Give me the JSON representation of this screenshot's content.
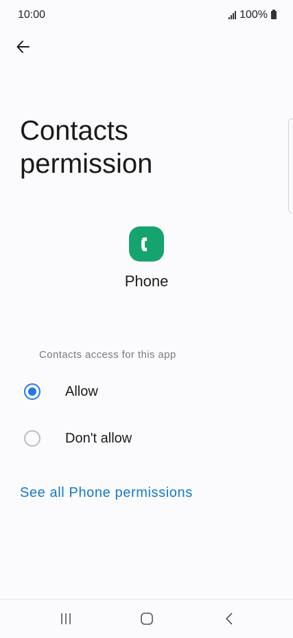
{
  "status_bar": {
    "time": "10:00",
    "battery": "100%"
  },
  "header": {
    "back_icon": "arrow-back-icon"
  },
  "page": {
    "title": "Contacts permission"
  },
  "app": {
    "name": "Phone",
    "icon": "phone-app-icon",
    "icon_color": "#15a46e"
  },
  "permission": {
    "section_label": "Contacts access for this app",
    "options": [
      {
        "label": "Allow",
        "selected": true
      },
      {
        "label": "Don't allow",
        "selected": false
      }
    ],
    "accent_color": "#1f7ae6"
  },
  "link": {
    "label": "See all Phone permissions",
    "color": "#1479c7"
  },
  "nav": {
    "recents_icon": "recents-icon",
    "home_icon": "home-icon",
    "back_icon": "back-chevron-icon"
  }
}
